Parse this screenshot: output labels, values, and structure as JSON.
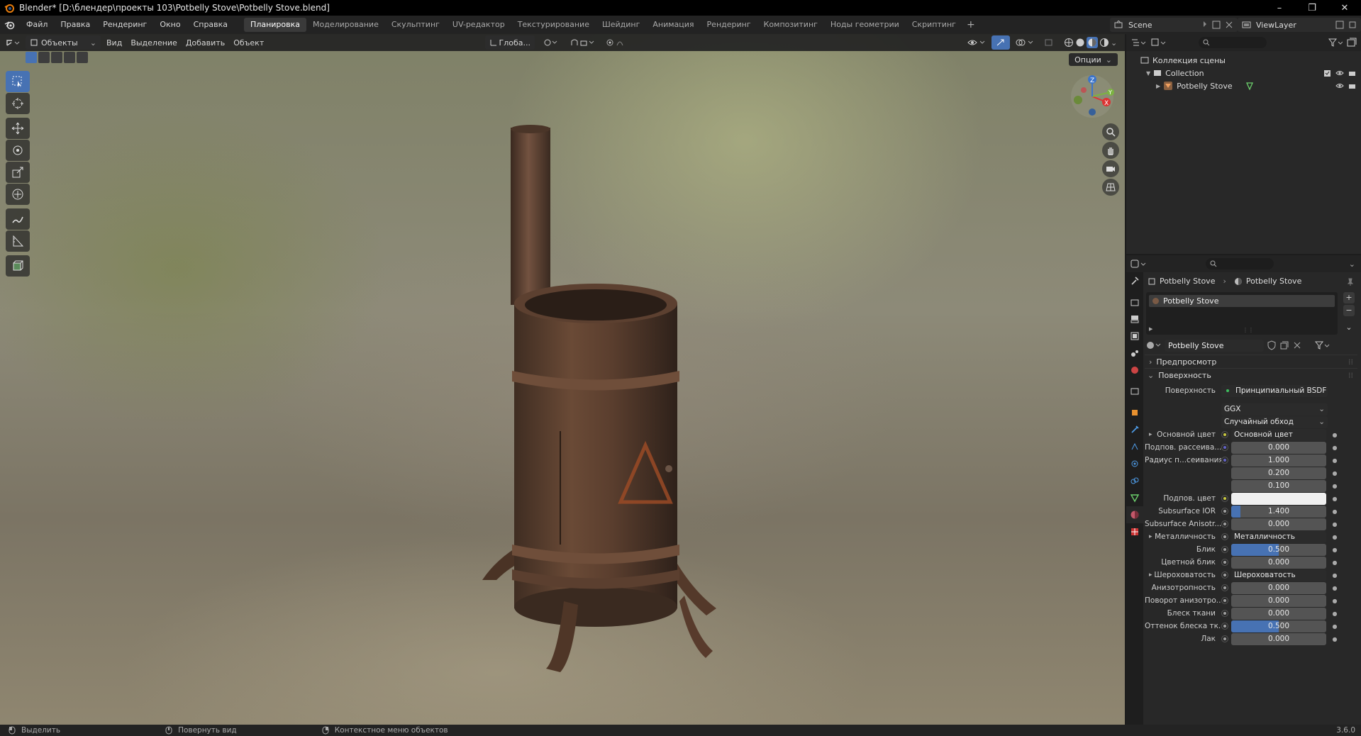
{
  "window": {
    "title": "Blender* [D:\\блендер\\проекты 103\\Potbelly Stove\\Potbelly Stove.blend]",
    "minimize": "–",
    "maximize": "❐",
    "close": "✕"
  },
  "menu": [
    "Файл",
    "Правка",
    "Рендеринг",
    "Окно",
    "Справка"
  ],
  "workspaces": [
    {
      "label": "Планировка",
      "active": true
    },
    {
      "label": "Моделирование"
    },
    {
      "label": "Скульптинг"
    },
    {
      "label": "UV-редактор"
    },
    {
      "label": "Текстурирование"
    },
    {
      "label": "Шейдинг"
    },
    {
      "label": "Анимация"
    },
    {
      "label": "Рендеринг"
    },
    {
      "label": "Композитинг"
    },
    {
      "label": "Ноды геометрии"
    },
    {
      "label": "Скриптинг"
    }
  ],
  "workspace_add": "+",
  "scene": {
    "name": "Scene",
    "view_layer": "ViewLayer"
  },
  "viewport_header": {
    "mode": "Объекты",
    "menus": [
      "Вид",
      "Выделение",
      "Добавить",
      "Объект"
    ],
    "orientation": "Глоба...",
    "options": "Опции"
  },
  "outliner": {
    "scene_collection": "Коллекция сцены",
    "collection": "Collection",
    "object": "Potbelly Stove"
  },
  "properties": {
    "breadcrumb_object": "Potbelly Stove",
    "breadcrumb_material": "Potbelly Stove",
    "material_slot": "Potbelly Stove",
    "material_name": "Potbelly Stove",
    "panel_preview": "Предпросмотр",
    "panel_surface": "Поверхность",
    "surface_label": "Поверхность",
    "surface_value": "Принципиальный BSDF",
    "distribution": "GGX",
    "subsurface_method": "Случайный обход",
    "rows": [
      {
        "label": "Основной цвет",
        "value": "Основной цвет",
        "kind": "link",
        "dot": "#c9c940"
      },
      {
        "label": "Подпов. рассеива...",
        "value": "0.000",
        "kind": "num",
        "dot": "#6363c7"
      },
      {
        "label": "Радиус п...сеивания",
        "value": "1.000",
        "kind": "num",
        "dot": "#6363c7"
      },
      {
        "label": "",
        "value": "0.200",
        "kind": "num",
        "dot": ""
      },
      {
        "label": "",
        "value": "0.100",
        "kind": "num",
        "dot": ""
      },
      {
        "label": "Подпов. цвет",
        "value": "",
        "kind": "color",
        "dot": "#c9c940"
      },
      {
        "label": "Subsurface IOR",
        "value": "1.400",
        "kind": "num",
        "fill": 0.1,
        "dot": "#a1a1a1"
      },
      {
        "label": "Subsurface Anisotr...",
        "value": "0.000",
        "kind": "num",
        "dot": "#a1a1a1"
      },
      {
        "label": "Металличность",
        "value": "Металличность",
        "kind": "link",
        "dot": "#a1a1a1"
      },
      {
        "label": "Блик",
        "value": "0.500",
        "kind": "num",
        "fill": 0.5,
        "dot": "#a1a1a1"
      },
      {
        "label": "Цветной блик",
        "value": "0.000",
        "kind": "num",
        "dot": "#a1a1a1"
      },
      {
        "label": "Шероховатость",
        "value": "Шероховатость",
        "kind": "link",
        "dot": "#a1a1a1"
      },
      {
        "label": "Анизотропность",
        "value": "0.000",
        "kind": "num",
        "dot": "#a1a1a1"
      },
      {
        "label": "Поворот анизотро...",
        "value": "0.000",
        "kind": "num",
        "dot": "#a1a1a1"
      },
      {
        "label": "Блеск ткани",
        "value": "0.000",
        "kind": "num",
        "dot": "#a1a1a1"
      },
      {
        "label": "Оттенок блеска тк...",
        "value": "0.500",
        "kind": "num",
        "fill": 0.5,
        "dot": "#a1a1a1"
      },
      {
        "label": "Лак",
        "value": "0.000",
        "kind": "num",
        "dot": "#a1a1a1"
      }
    ]
  },
  "statusbar": {
    "select": "Выделить",
    "rotate": "Повернуть вид",
    "context": "Контекстное меню объектов",
    "version": "3.6.0"
  },
  "gizmo": {
    "x": "X",
    "y": "Y",
    "z": "Z"
  },
  "colors": {
    "accent": "#4772b3",
    "panel": "#282828",
    "header": "#232323"
  }
}
